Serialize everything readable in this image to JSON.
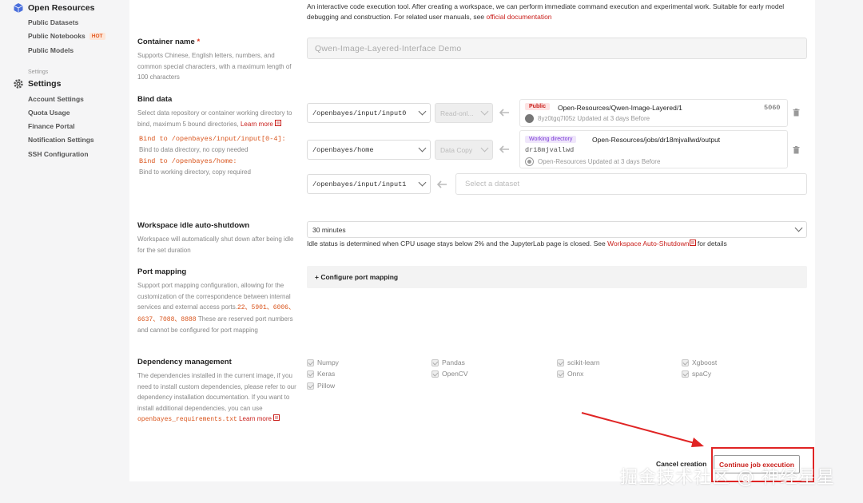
{
  "sidebar": {
    "group1": {
      "title": "Open Resources",
      "items": [
        "Public Datasets",
        "Public Notebooks",
        "Public Models"
      ],
      "hot_badge": "HOT"
    },
    "section_label": "Settings",
    "group2": {
      "title": "Settings",
      "items": [
        "Account Settings",
        "Quota Usage",
        "Finance Portal",
        "Notification Settings",
        "SSH Configuration"
      ]
    }
  },
  "intro": {
    "text": "An interactive code execution tool. After creating a workspace, we can perform immediate command execution and experimental work. Suitable for early model debugging and construction. For related user manuals, see",
    "link": "official documentation"
  },
  "container_name": {
    "label": "Container name",
    "required_mark": "*",
    "desc": "Supports Chinese, English letters, numbers, and common special characters, with a maximum length of 100 characters",
    "value": "Qwen-Image-Layered-Interface Demo"
  },
  "bind_data": {
    "label": "Bind data",
    "desc": "Select data repository or container working directory to bind, maximum 5 bound directories,",
    "learn_more": "Learn more",
    "rules": [
      {
        "path": "Bind to /openbayes/input/input[0-4]:",
        "note": "Bind to data directory, no copy needed"
      },
      {
        "path": "Bind to /openbayes/home:",
        "note": "Bind to working directory, copy required"
      }
    ],
    "rows": [
      {
        "path": "/openbayes/input/input0",
        "mode": "Read-onl..."
      },
      {
        "path": "/openbayes/home",
        "mode": "Data Copy"
      },
      {
        "path": "/openbayes/input/input1",
        "placeholder": "Select a dataset"
      }
    ],
    "cards": [
      {
        "tag": "Public",
        "title": "Open-Resources/Qwen-Image-Layered/1",
        "size": "5060",
        "meta": "8yz0tgq7l05z  Updated at 3 days Before"
      },
      {
        "tag": "Working directory",
        "title": "Open-Resources/jobs/dr18mjvallwd/output",
        "id": "dr18mjvallwd",
        "meta": "Open-Resources Updated at 3 days Before"
      }
    ]
  },
  "idle": {
    "label": "Workspace idle auto-shutdown",
    "desc": "Workspace will automatically shut down after being idle for the set duration",
    "value": "30 minutes",
    "note": "Idle status is determined when CPU usage stays below 2% and the JupyterLab page is closed. See",
    "link": "Workspace Auto-Shutdown",
    "note_end": "for details"
  },
  "port": {
    "label": "Port mapping",
    "desc": "Support port mapping configuration, allowing for the customization of the correspondence between internal services and external access ports.",
    "ports": "22、5901、6006、6637、7088、8888",
    "desc2": "These are reserved port numbers and cannot be configured for port mapping",
    "button": "+ Configure port mapping"
  },
  "deps": {
    "label": "Dependency management",
    "desc": "The dependencies installed in the current image, if you need to install custom dependencies, please refer to our dependency installation documentation. If you want to install additional dependencies, you can use",
    "file": "openbayes_requirements.txt",
    "learn_more": "Learn more",
    "items": [
      "Numpy",
      "Pandas",
      "scikit-learn",
      "Xgboost",
      "Keras",
      "OpenCV",
      "Onnx",
      "spaCy",
      "Pillow"
    ]
  },
  "actions": {
    "cancel": "Cancel creation",
    "continue": "Continue job execution"
  },
  "watermark": "掘金技术社区 @ 神经星星",
  "colors": {
    "accent_red": "#c9201c",
    "orange": "#d9541c",
    "highlight": "#e02424"
  }
}
